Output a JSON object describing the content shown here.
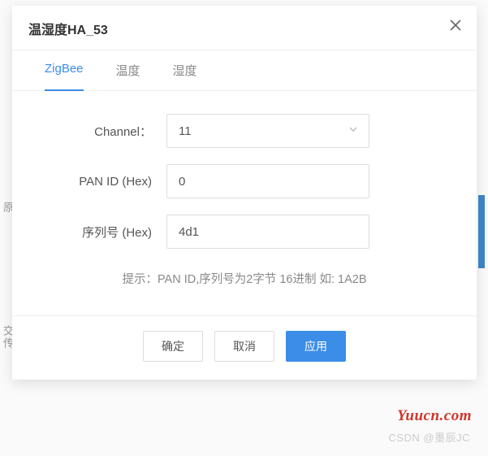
{
  "dialog": {
    "title": "温湿度HA_53"
  },
  "tabs": [
    {
      "label": "ZigBee",
      "active": true
    },
    {
      "label": "温度",
      "active": false
    },
    {
      "label": "湿度",
      "active": false
    }
  ],
  "form": {
    "channel_label": "Channel：",
    "channel_value": "11",
    "panid_label": "PAN ID (Hex)",
    "panid_value": "0",
    "serial_label": "序列号 (Hex)",
    "serial_value": "4d1"
  },
  "hint": "提示：PAN ID,序列号为2字节 16进制 如: 1A2B",
  "buttons": {
    "ok": "确定",
    "cancel": "取消",
    "apply": "应用"
  },
  "misc": {
    "watermark1": "Yuucn.com",
    "watermark2": "CSDN @墨辰JC",
    "bg_text1": "原",
    "bg_text2": "交传"
  }
}
